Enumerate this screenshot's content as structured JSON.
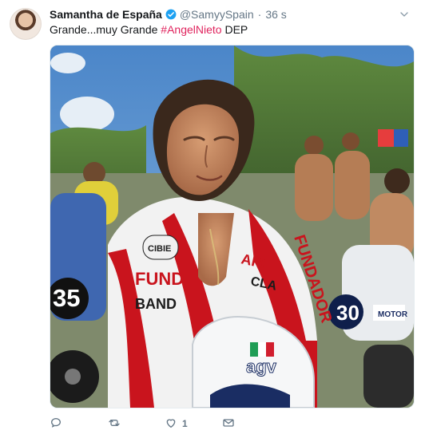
{
  "tweet": {
    "author_name": "Samantha de España",
    "handle": "@SamyySpain",
    "separator": "·",
    "time": "36 s",
    "text_before": "Grande...muy Grande ",
    "hashtag": "#AngelNieto",
    "text_after": " DEP"
  },
  "media": {
    "rider_number": "35",
    "bike_number": "30",
    "helmet_brand": "agv",
    "suit_sponsor_1": "CIBIE",
    "suit_sponsor_2": "FUND",
    "suit_sponsor_3": "BAND",
    "sleeve_text": "FUNDADOR",
    "bike_brand": "MOTOR",
    "sleeve_text_2": "API",
    "jacket_text": "CLA"
  },
  "actions": {
    "reply_icon": "reply-icon",
    "retweet_icon": "retweet-icon",
    "like_icon": "heart-icon",
    "like_count": "1",
    "dm_icon": "envelope-icon"
  },
  "colors": {
    "hashtag": "#e0245e",
    "verified": "#1da1f2",
    "muted": "#657786"
  }
}
